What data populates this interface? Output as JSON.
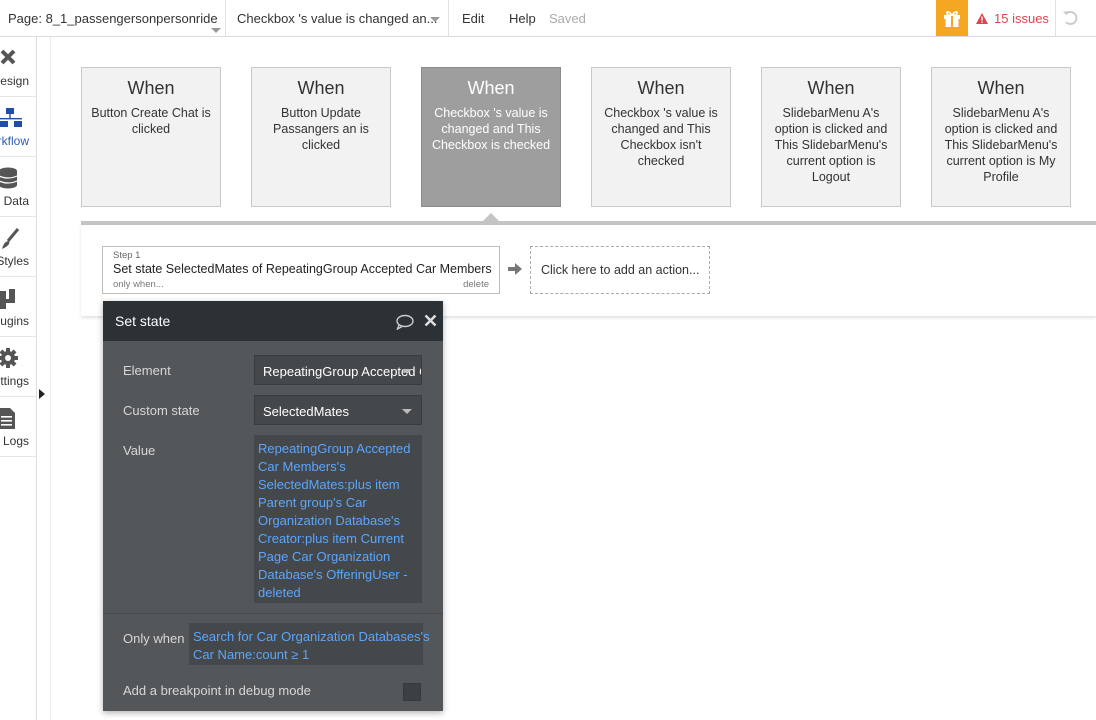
{
  "topbar": {
    "page_label": "Page: 8_1_passengersonpersonride",
    "workflow_label": "Checkbox 's value is changed an...",
    "edit_label": "Edit",
    "help_label": "Help",
    "saved_label": "Saved",
    "issues_label": "15 issues"
  },
  "sidebar": {
    "items": [
      {
        "label": "Design",
        "icon": "design-icon"
      },
      {
        "label": "Workflow",
        "icon": "workflow-icon"
      },
      {
        "label": "Data",
        "icon": "database-icon"
      },
      {
        "label": "Styles",
        "icon": "brush-icon"
      },
      {
        "label": "Plugins",
        "icon": "plug-icon"
      },
      {
        "label": "Settings",
        "icon": "gear-icon"
      },
      {
        "label": "Logs",
        "icon": "document-icon"
      }
    ]
  },
  "events": [
    {
      "when": "When",
      "desc": "Button Create Chat is clicked"
    },
    {
      "when": "When",
      "desc": "Button Update Passangers an is clicked"
    },
    {
      "when": "When",
      "desc": "Checkbox 's value is changed and This Checkbox is checked"
    },
    {
      "when": "When",
      "desc": "Checkbox 's value is changed and This Checkbox isn't checked"
    },
    {
      "when": "When",
      "desc": "SlidebarMenu A's option is clicked and This SlidebarMenu's current option is Logout"
    },
    {
      "when": "When",
      "desc": "SlidebarMenu A's option is clicked and This SlidebarMenu's current option is My Profile"
    }
  ],
  "step": {
    "number": "Step 1",
    "title": "Set state SelectedMates of RepeatingGroup Accepted Car Members",
    "only_when": "only when...",
    "delete": "delete"
  },
  "add_action": "Click here to add an action...",
  "panel": {
    "title": "Set state",
    "element_label": "Element",
    "element_value": "RepeatingGroup Accepted Car Members",
    "custom_state_label": "Custom state",
    "custom_state_value": "SelectedMates",
    "value_label": "Value",
    "value_lines": [
      "RepeatingGroup Accepted",
      "Car Members's",
      "SelectedMates:plus item",
      "Parent group's Car",
      "Organization Database's",
      "Creator:plus item Current",
      "Page Car Organization",
      "Database's OfferingUser -",
      "deleted"
    ],
    "only_when_label": "Only when",
    "only_when_lines": [
      "Search for Car Organization Databases's",
      "Car Name:count ≥ 1"
    ],
    "breakpoint_label": "Add a breakpoint in debug mode"
  }
}
